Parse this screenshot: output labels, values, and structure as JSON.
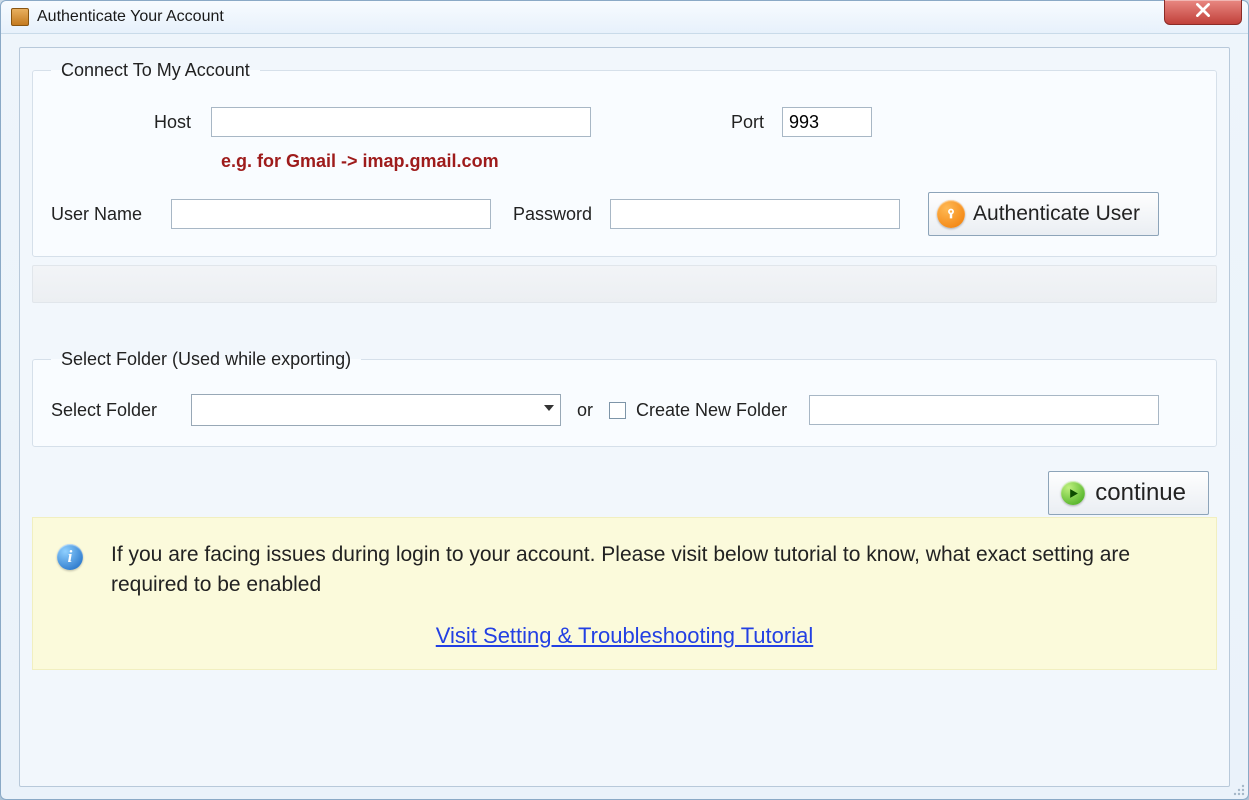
{
  "window": {
    "title": "Authenticate Your Account"
  },
  "connect": {
    "legend": "Connect To My Account",
    "host_label": "Host",
    "host_value": "",
    "port_label": "Port",
    "port_value": "993",
    "hint": "e.g. for Gmail -> imap.gmail.com",
    "username_label": "User Name",
    "username_value": "",
    "password_label": "Password",
    "password_value": "",
    "auth_button": "Authenticate User"
  },
  "folder": {
    "legend": "Select Folder (Used while exporting)",
    "select_label": "Select Folder",
    "selected_value": "",
    "or_label": "or",
    "create_checkbox_label": "Create New Folder",
    "new_folder_value": ""
  },
  "continue_button": "continue",
  "info": {
    "text": "If you are facing issues during login to your account. Please visit below tutorial to know, what exact setting are required to be enabled",
    "link": "Visit Setting & Troubleshooting Tutorial"
  }
}
